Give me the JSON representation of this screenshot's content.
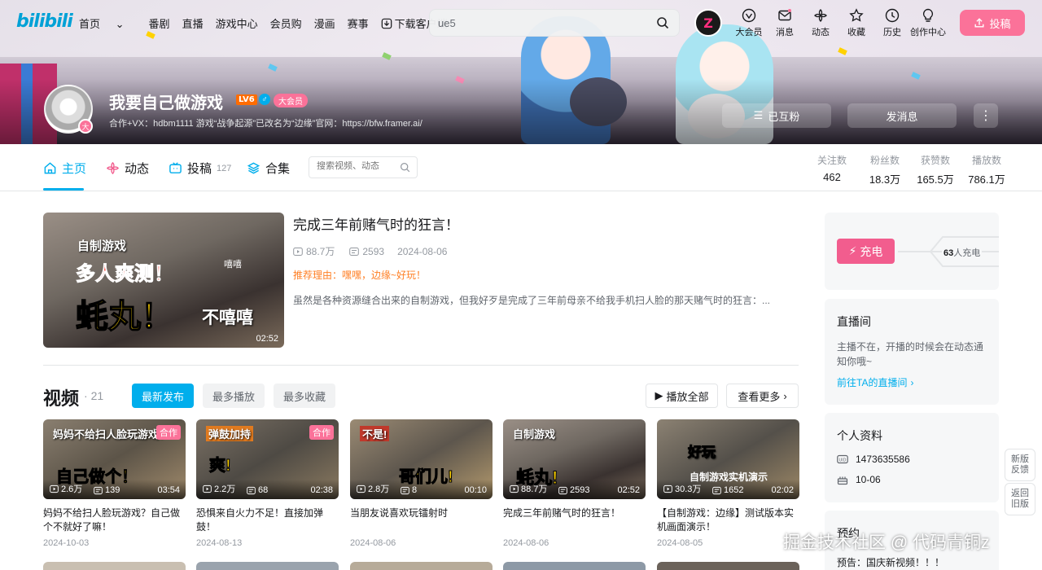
{
  "topnav": {
    "logo": "bilibili",
    "links": [
      "首页",
      "番剧",
      "直播",
      "游戏中心",
      "会员购",
      "漫画",
      "赛事",
      "下载客户端"
    ],
    "search_value": "ue5",
    "avatar_badge": "Z",
    "icons": [
      {
        "label": "大会员",
        "icon": "vip-icon"
      },
      {
        "label": "消息",
        "icon": "message-icon"
      },
      {
        "label": "动态",
        "icon": "dynamic-icon"
      },
      {
        "label": "收藏",
        "icon": "star-icon"
      },
      {
        "label": "历史",
        "icon": "clock-icon"
      },
      {
        "label": "创作中心",
        "icon": "bulb-icon"
      }
    ],
    "upload_label": "投稿"
  },
  "profile": {
    "name": "我要自己做游戏",
    "level": "LV6",
    "gender": "♂",
    "vip": "大会员",
    "avatar_badge": "大",
    "sign": "合作+VX：hdbm1111 游戏“战争起源”已改名为“边缘”官网：https://bfw.framer.ai/",
    "mutual_label": "已互粉",
    "message_label": "发消息",
    "more_label": "⋮"
  },
  "tabs": [
    {
      "label": "主页",
      "icon": "home-icon",
      "count": ""
    },
    {
      "label": "动态",
      "icon": "dynamic-icon",
      "count": ""
    },
    {
      "label": "投稿",
      "icon": "tv-icon",
      "count": "127"
    },
    {
      "label": "合集",
      "icon": "layers-icon",
      "count": ""
    }
  ],
  "tab_search_placeholder": "搜索视频、动态",
  "stats": [
    {
      "label": "关注数",
      "value": "462"
    },
    {
      "label": "粉丝数",
      "value": "18.3万"
    },
    {
      "label": "获赞数",
      "value": "165.5万"
    },
    {
      "label": "播放数",
      "value": "786.1万"
    }
  ],
  "featured": {
    "title": "完成三年前赌气时的狂言！",
    "plays": "88.7万",
    "danmaku": "2593",
    "date": "2024-08-06",
    "reason": "推荐理由：嘿嘿，边缘~好玩！",
    "desc": "虽然是各种资源缝合出来的自制游戏，但我好歹是完成了三年前母亲不给我手机扫人脸的那天赌气时的狂言：...",
    "thumb_texts": [
      "自制游戏",
      "多人爽测！",
      "蚝丸！",
      "不嘻嘻",
      "嘻嘻"
    ],
    "duration": "02:52"
  },
  "videos_section": {
    "title": "视频",
    "count": "21",
    "filters": [
      "最新发布",
      "最多播放",
      "最多收藏"
    ],
    "play_all": "播放全部",
    "see_more": "查看更多"
  },
  "videos": [
    {
      "title": "妈妈不给扫人脸玩游戏？自己做个不就好了嘛！",
      "date": "2024-10-03",
      "plays": "2.6万",
      "danmaku": "139",
      "duration": "03:54",
      "tag": "合作",
      "cap1": "妈妈不给扫人脸玩游戏？",
      "cap2": "自己做个！"
    },
    {
      "title": "恐惧来自火力不足！直接加弹鼓！",
      "date": "2024-08-13",
      "plays": "2.2万",
      "danmaku": "68",
      "duration": "02:38",
      "tag": "合作",
      "cap1": "弹鼓加持",
      "cap2": "爽!"
    },
    {
      "title": "当朋友说喜欢玩镭射时",
      "date": "2024-08-06",
      "plays": "2.8万",
      "danmaku": "8",
      "duration": "00:10",
      "tag": "",
      "cap1": "不是!",
      "cap2": "哥们儿!"
    },
    {
      "title": "完成三年前赌气时的狂言！",
      "date": "2024-08-06",
      "plays": "88.7万",
      "danmaku": "2593",
      "duration": "02:52",
      "tag": "",
      "cap1": "自制游戏",
      "cap2": "蚝丸!"
    },
    {
      "title": "【自制游戏：边缘】测试版本实机画面演示！",
      "date": "2024-08-05",
      "plays": "30.3万",
      "danmaku": "1652",
      "duration": "02:02",
      "tag": "",
      "cap1": "好玩",
      "cap2": "自制游戏实机演示"
    }
  ],
  "charge": {
    "button": "充电",
    "count": "63",
    "count_suffix": "人充电"
  },
  "live": {
    "title": "直播间",
    "text": "主播不在，开播的时候会在动态通知你哦~",
    "link": "前往TA的直播间"
  },
  "info": {
    "title": "个人资料",
    "uid": "1473635586",
    "birthday": "10-06"
  },
  "notice": {
    "title": "预约",
    "text": "预告：国庆新视频！！！"
  },
  "side": {
    "feedback": [
      "新版",
      "反馈"
    ],
    "old": [
      "返回",
      "旧版"
    ]
  },
  "watermark": "掘金技术社区 @ 代码青铜z",
  "colors": {
    "accent": "#00aeec",
    "pink": "#fb7299",
    "reason": "#ff7f24"
  }
}
